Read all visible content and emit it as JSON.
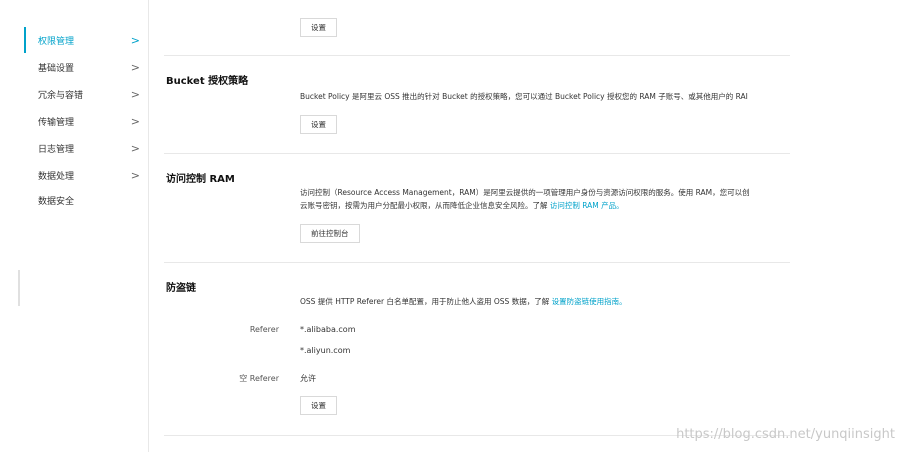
{
  "sidebar": {
    "items": [
      {
        "label": "权限管理",
        "chevron": ">"
      },
      {
        "label": "基础设置",
        "chevron": ">"
      },
      {
        "label": "冗余与容错",
        "chevron": ">"
      },
      {
        "label": "传输管理",
        "chevron": ">"
      },
      {
        "label": "日志管理",
        "chevron": ">"
      },
      {
        "label": "数据处理",
        "chevron": ">"
      },
      {
        "label": "数据安全",
        "chevron": ""
      }
    ]
  },
  "top": {
    "button_label": "设置"
  },
  "bucket_policy": {
    "title": "Bucket 授权策略",
    "description": "Bucket Policy 是阿里云 OSS 推出的针对 Bucket 的授权策略，您可以通过 Bucket Policy 授权您的 RAM 子账号、或其他用户的 RAI",
    "button_label": "设置"
  },
  "ram": {
    "title": "访问控制 RAM",
    "description_line1": "访问控制（Resource Access Management，RAM）是阿里云提供的一项管理用户身份与资源访问权限的服务。使用 RAM，您可以创",
    "description_line2": "云账号密钥，按需为用户分配最小权限，从而降低企业信息安全风险。了解 ",
    "link": "访问控制 RAM 产品。",
    "button_label": "前往控制台"
  },
  "hotlink": {
    "title": "防盗链",
    "description": "OSS 提供 HTTP Referer 白名单配置，用于防止他人盗用 OSS 数据，了解 ",
    "link": "设置防盗链使用指南。",
    "referer_label": "Referer",
    "referer_values": [
      "*.alibaba.com",
      "*.aliyun.com"
    ],
    "empty_referer_label": "空 Referer",
    "empty_referer_value": "允许",
    "button_label": "设置"
  },
  "watermark": "https://blog.csdn.net/yunqiinsight"
}
